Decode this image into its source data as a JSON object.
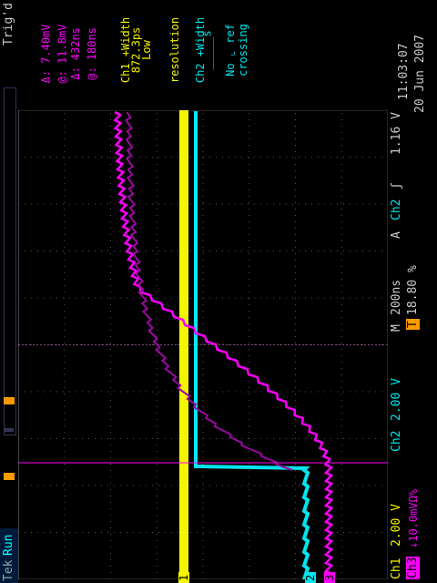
{
  "status": {
    "mode": "Run",
    "trigger": "Trig'd"
  },
  "cursor": {
    "d_v": "7.40mV",
    "at_v": "11.8mV",
    "d_t": "432ns",
    "at_t": "180ns",
    "d_sym": "Δ:",
    "at_sym": "@:"
  },
  "meas": {
    "ch1_l1": "Ch1 +Width",
    "ch1_l2": "872.3ps",
    "ch1_l3": "Low",
    "ch1_l4": "resolution",
    "ch2_l1": "Ch2 +Width",
    "ch2_l2": "_____s",
    "ch2_l3": "No ⌞ ref",
    "ch2_l4": "crossing"
  },
  "datetime": {
    "date": "20 Jun 2007",
    "time": "11:03:07"
  },
  "bottom": {
    "ch1_label": "Ch1",
    "ch1_scale": "2.00 V",
    "ch2_label": "Ch2",
    "ch2_scale": "2.00 V",
    "time_label": "M",
    "time_scale": "200ns",
    "trig_label": "A",
    "trig_ch": "Ch2",
    "trig_slope": "ʃ",
    "trig_level": "1.16 V",
    "ch3_label": "Ch3",
    "ch3_scale": "↓10.0mVΩ%",
    "pos_label": "T",
    "pos_value": "18.80 %"
  },
  "markers": {
    "ch1": "1",
    "ch2": "2",
    "ch3": "3"
  },
  "colors": {
    "ch1": "#f5f500",
    "ch2": "#00e6f0",
    "ch3": "#ff00ff",
    "ch3dim": "#9a0aa0",
    "orange": "#ff9a00"
  }
}
